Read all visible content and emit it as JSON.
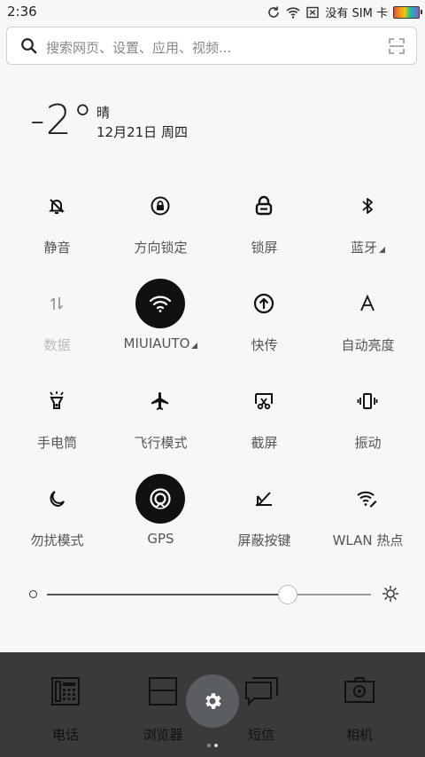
{
  "status_bar": {
    "time": "2:36",
    "carrier": "没有 SIM 卡",
    "icons": [
      "sync-icon",
      "wifi-icon",
      "no-sim-icon",
      "battery-icon"
    ]
  },
  "search": {
    "placeholder": "搜索网页、设置、应用、视频...",
    "icons": [
      "search-icon",
      "scan-icon"
    ]
  },
  "weather": {
    "temperature": "-2°",
    "condition": "晴",
    "date": "12月21日 周四"
  },
  "quick_toggles": [
    {
      "id": "mute",
      "label": "静音",
      "icon": "bell-off-icon",
      "active": false,
      "dim": false,
      "has_more": false
    },
    {
      "id": "rotation-lock",
      "label": "方向锁定",
      "icon": "rotation-lock-icon",
      "active": false,
      "dim": false,
      "has_more": false
    },
    {
      "id": "lock-screen",
      "label": "锁屏",
      "icon": "lock-icon",
      "active": false,
      "dim": false,
      "has_more": false
    },
    {
      "id": "bluetooth",
      "label": "蓝牙",
      "icon": "bluetooth-icon",
      "active": false,
      "dim": false,
      "has_more": true
    },
    {
      "id": "data",
      "label": "数据",
      "icon": "data-arrows-icon",
      "active": false,
      "dim": true,
      "has_more": false
    },
    {
      "id": "wifi",
      "label": "MIUIAUTO",
      "icon": "wifi-icon",
      "active": true,
      "dim": false,
      "has_more": true
    },
    {
      "id": "quick-send",
      "label": "快传",
      "icon": "upload-icon",
      "active": false,
      "dim": false,
      "has_more": false
    },
    {
      "id": "auto-brightness",
      "label": "自动亮度",
      "icon": "auto-brightness-icon",
      "active": false,
      "dim": false,
      "has_more": false
    },
    {
      "id": "flashlight",
      "label": "手电筒",
      "icon": "flashlight-icon",
      "active": false,
      "dim": false,
      "has_more": false
    },
    {
      "id": "airplane",
      "label": "飞行模式",
      "icon": "airplane-icon",
      "active": false,
      "dim": false,
      "has_more": false
    },
    {
      "id": "screenshot",
      "label": "截屏",
      "icon": "screenshot-icon",
      "active": false,
      "dim": false,
      "has_more": false
    },
    {
      "id": "vibrate",
      "label": "振动",
      "icon": "vibrate-icon",
      "active": false,
      "dim": false,
      "has_more": false
    },
    {
      "id": "dnd",
      "label": "勿扰模式",
      "icon": "moon-icon",
      "active": false,
      "dim": false,
      "has_more": false
    },
    {
      "id": "gps",
      "label": "GPS",
      "icon": "gps-icon",
      "active": true,
      "dim": false,
      "has_more": false
    },
    {
      "id": "mask-buttons",
      "label": "屏蔽按键",
      "icon": "mask-buttons-icon",
      "active": false,
      "dim": false,
      "has_more": false
    },
    {
      "id": "hotspot",
      "label": "WLAN 热点",
      "icon": "hotspot-icon",
      "active": false,
      "dim": false,
      "has_more": false
    }
  ],
  "brightness": {
    "level": 0.74
  },
  "dock": {
    "apps": [
      {
        "label": "电话",
        "icon": "phone-icon"
      },
      {
        "label": "浏览器",
        "icon": "browser-icon"
      },
      {
        "label": "短信",
        "icon": "messages-icon"
      },
      {
        "label": "相机",
        "icon": "camera-icon"
      }
    ],
    "settings_icon": "gear-icon",
    "page_index": 2,
    "page_count": 2
  },
  "colors": {
    "active_toggle": "#111111",
    "dock_bg": "#3a3a3a",
    "fab_bg": "#5a5e62"
  }
}
